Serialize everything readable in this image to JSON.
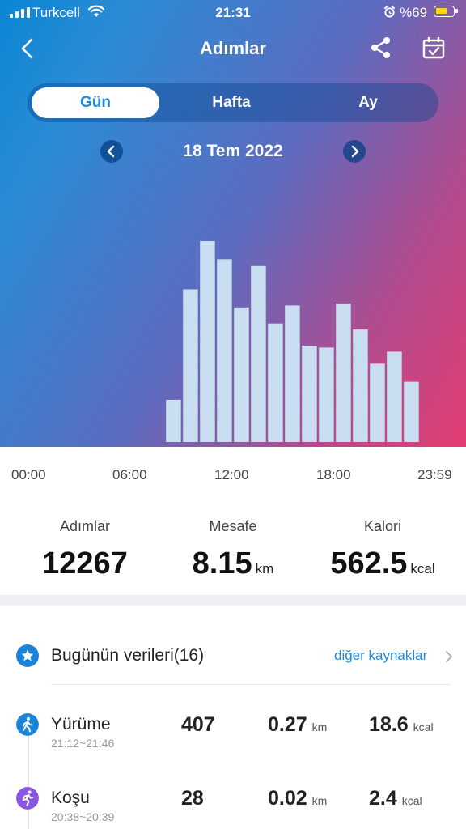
{
  "status_bar": {
    "carrier": "Turkcell",
    "time": "21:31",
    "battery_text": "%69",
    "battery_level_percent": 69
  },
  "header": {
    "title": "Adımlar",
    "back_icon": "chevron-left-icon",
    "share_icon": "share-icon",
    "calendar_icon": "calendar-check-icon"
  },
  "period_tabs": [
    {
      "label": "Gün",
      "selected": true
    },
    {
      "label": "Hafta",
      "selected": false
    },
    {
      "label": "Ay",
      "selected": false
    }
  ],
  "date_nav": {
    "date": "18 Tem 2022"
  },
  "chart_data": {
    "type": "bar",
    "x_range_hours": [
      0,
      24
    ],
    "xticks": [
      "00:00",
      "06:00",
      "12:00",
      "18:00",
      "23:59"
    ],
    "bars": [
      {
        "hour": 8,
        "value": 0.21
      },
      {
        "hour": 9,
        "value": 0.76
      },
      {
        "hour": 10,
        "value": 1.0
      },
      {
        "hour": 11,
        "value": 0.91
      },
      {
        "hour": 12,
        "value": 0.67
      },
      {
        "hour": 13,
        "value": 0.88
      },
      {
        "hour": 14,
        "value": 0.59
      },
      {
        "hour": 15,
        "value": 0.68
      },
      {
        "hour": 16,
        "value": 0.48
      },
      {
        "hour": 17,
        "value": 0.47
      },
      {
        "hour": 18,
        "value": 0.69
      },
      {
        "hour": 19,
        "value": 0.56
      },
      {
        "hour": 20,
        "value": 0.39
      },
      {
        "hour": 21,
        "value": 0.45
      },
      {
        "hour": 22,
        "value": 0.3
      }
    ],
    "bar_color": "#c9def0"
  },
  "summary": {
    "steps": {
      "label": "Adımlar",
      "value": "12267"
    },
    "distance": {
      "label": "Mesafe",
      "value": "8.15",
      "unit": "km"
    },
    "calories": {
      "label": "Kalori",
      "value": "562.5",
      "unit": "kcal"
    }
  },
  "today": {
    "title": "Bugünün verileri(16)",
    "other_sources": "diğer kaynaklar",
    "star_icon": "star-icon",
    "activities": [
      {
        "name": "Yürüme",
        "time_range": "21:12~21:46",
        "steps": "407",
        "distance": "0.27",
        "distance_unit": "km",
        "calories": "18.6",
        "calories_unit": "kcal",
        "icon": "walking-icon",
        "color": "#1b84d6"
      },
      {
        "name": "Koşu",
        "time_range": "20:38~20:39",
        "steps": "28",
        "distance": "0.02",
        "distance_unit": "km",
        "calories": "2.4",
        "calories_unit": "kcal",
        "icon": "running-icon",
        "color": "#8a55e0"
      }
    ]
  },
  "colors": {
    "accent": "#1d8ae0",
    "gradient_start": "#0a86d4",
    "gradient_end": "#e33d72"
  }
}
